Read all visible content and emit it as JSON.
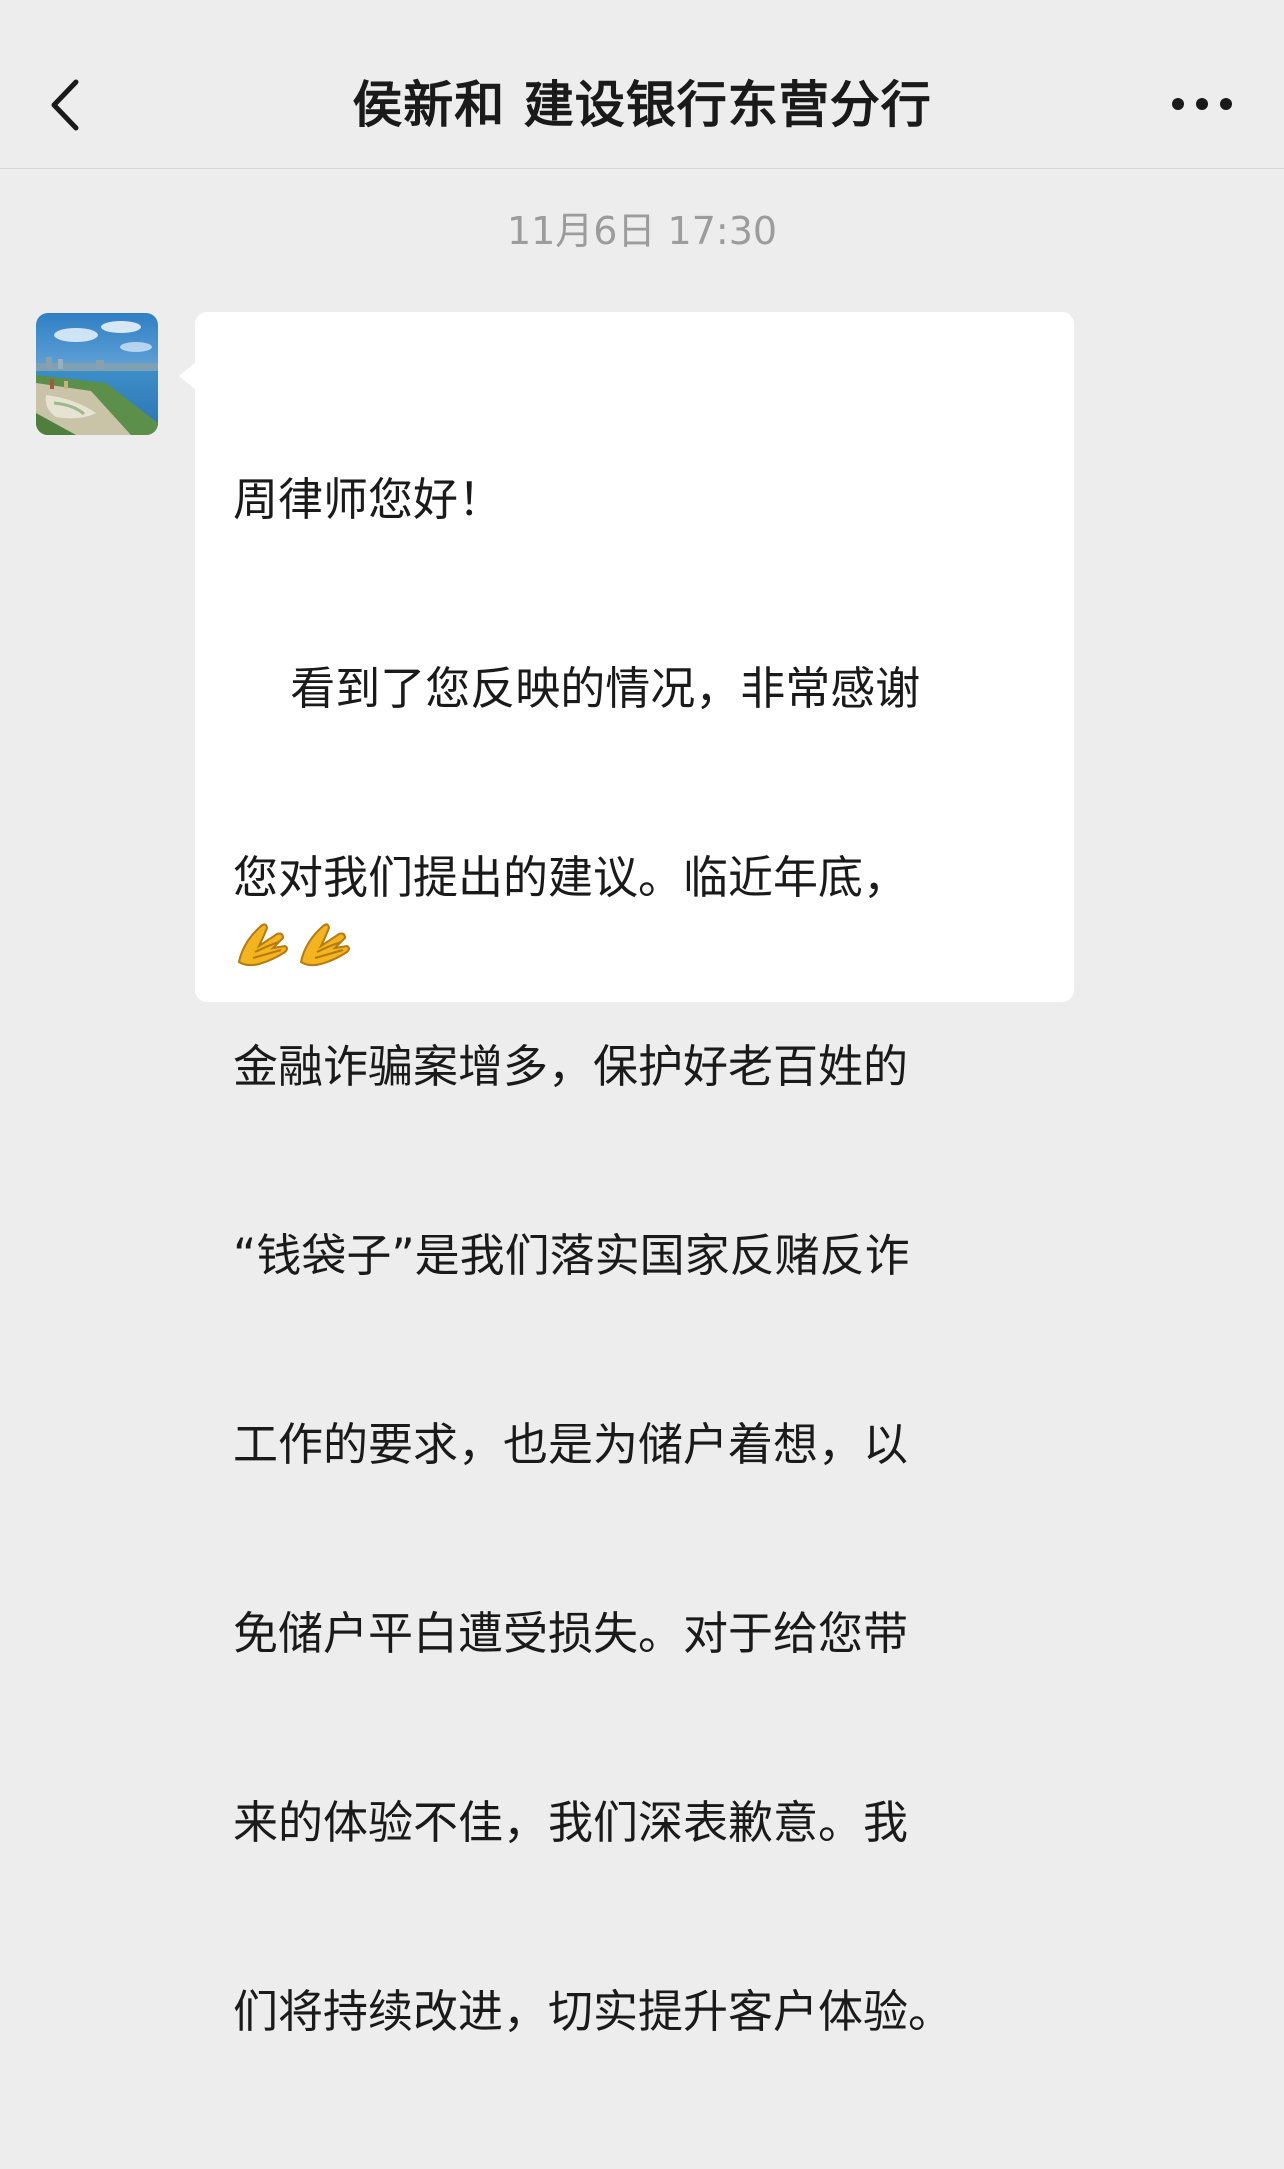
{
  "header": {
    "back_icon": "chevron-left-icon",
    "title": "侯新和 建设银行东营分行",
    "more_icon": "ellipsis-icon"
  },
  "timestamp": "11月6日 17:30",
  "message": {
    "sender_avatar": "city-waterfront-photo",
    "lines": [
      "周律师您好！",
      "    看到了您反映的情况，非常感谢",
      "您对我们提出的建议。临近年底，",
      "金融诈骗案增多，保护好老百姓的",
      "“钱袋子”是我们落实国家反赌反诈",
      "工作的要求，也是为储户着想，以",
      "免储户平白遭受损失。对于给您带",
      "来的体验不佳，我们深表歉意。我",
      "们将持续改进，切实提升客户体验。"
    ],
    "emojis": [
      "🙏",
      "🙏"
    ],
    "emoji_icon": "folded-hands-emoji"
  },
  "colors": {
    "background": "#ededed",
    "bubble": "#ffffff",
    "text": "#1a1a1a",
    "timestamp": "#9c9c9c"
  }
}
